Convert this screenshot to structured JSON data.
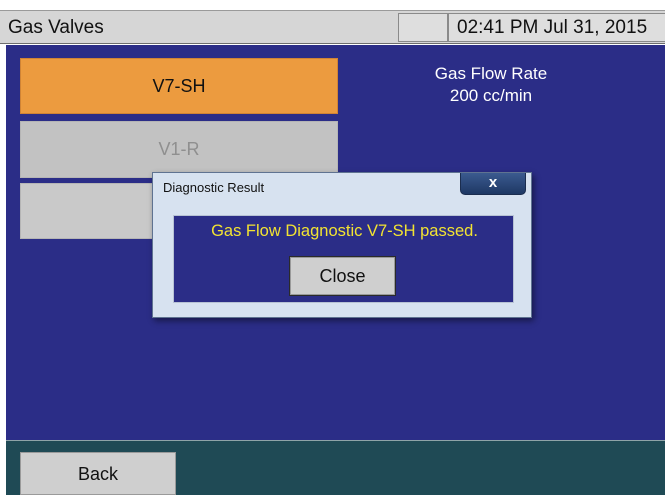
{
  "titlebar": {
    "title": "Gas Valves",
    "datetime": "02:41 PM Jul 31, 2015"
  },
  "valves": {
    "active_label": "V7-SH",
    "disabled_label": "V1-R",
    "third_label": ""
  },
  "flow": {
    "label": "Gas Flow Rate",
    "value": "200 cc/min"
  },
  "dialog": {
    "title": "Diagnostic Result",
    "close_glyph": "x",
    "message": "Gas Flow Diagnostic V7-SH passed.",
    "close_label": "Close"
  },
  "footer": {
    "back_label": "Back"
  },
  "colors": {
    "panel": "#2b2d87",
    "active_button": "#ec9b3f",
    "message_text": "#f2e332",
    "footer": "#1f4a55"
  }
}
